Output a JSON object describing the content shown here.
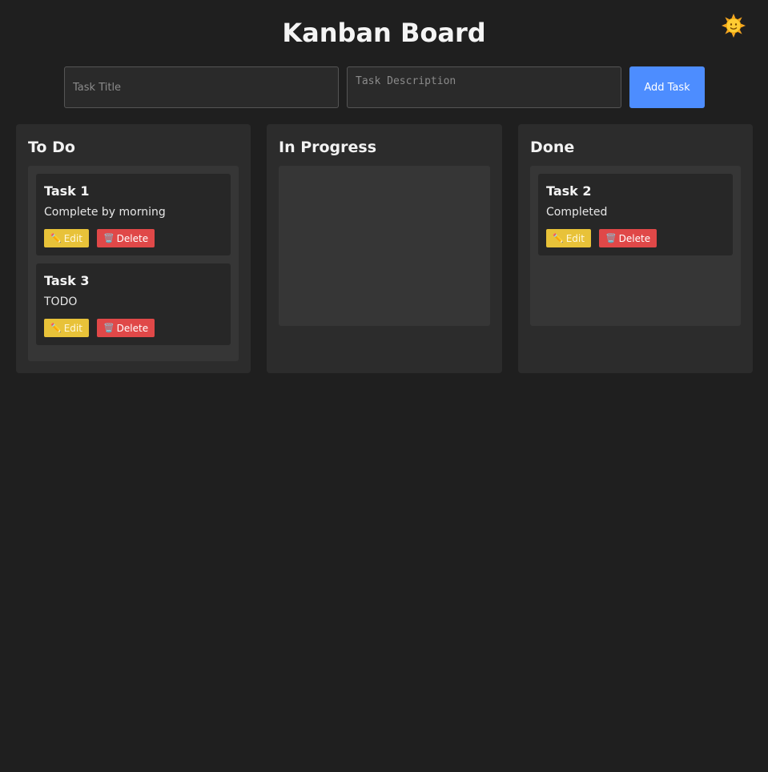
{
  "header": {
    "title": "Kanban Board",
    "theme_icon": "sun-face-icon"
  },
  "form": {
    "title_placeholder": "Task Title",
    "description_placeholder": "Task Description",
    "title_value": "",
    "description_value": "",
    "add_label": "Add Task"
  },
  "columns": [
    {
      "title": "To Do",
      "tasks": [
        {
          "title": "Task 1",
          "description": "Complete by morning",
          "edit_label": "Edit",
          "delete_label": "Delete"
        },
        {
          "title": "Task 3",
          "description": "TODO",
          "edit_label": "Edit",
          "delete_label": "Delete"
        }
      ]
    },
    {
      "title": "In Progress",
      "tasks": []
    },
    {
      "title": "Done",
      "tasks": [
        {
          "title": "Task 2",
          "description": "Completed",
          "edit_label": "Edit",
          "delete_label": "Delete"
        }
      ]
    }
  ],
  "colors": {
    "background": "#1f1f1f",
    "column": "#2c2c2c",
    "dropzone": "#363636",
    "card": "#272727",
    "accent": "#4d8dff",
    "edit": "#e8c239",
    "delete": "#e04848"
  },
  "icons": {
    "edit": "pencil-icon",
    "delete": "wastebasket-icon"
  }
}
